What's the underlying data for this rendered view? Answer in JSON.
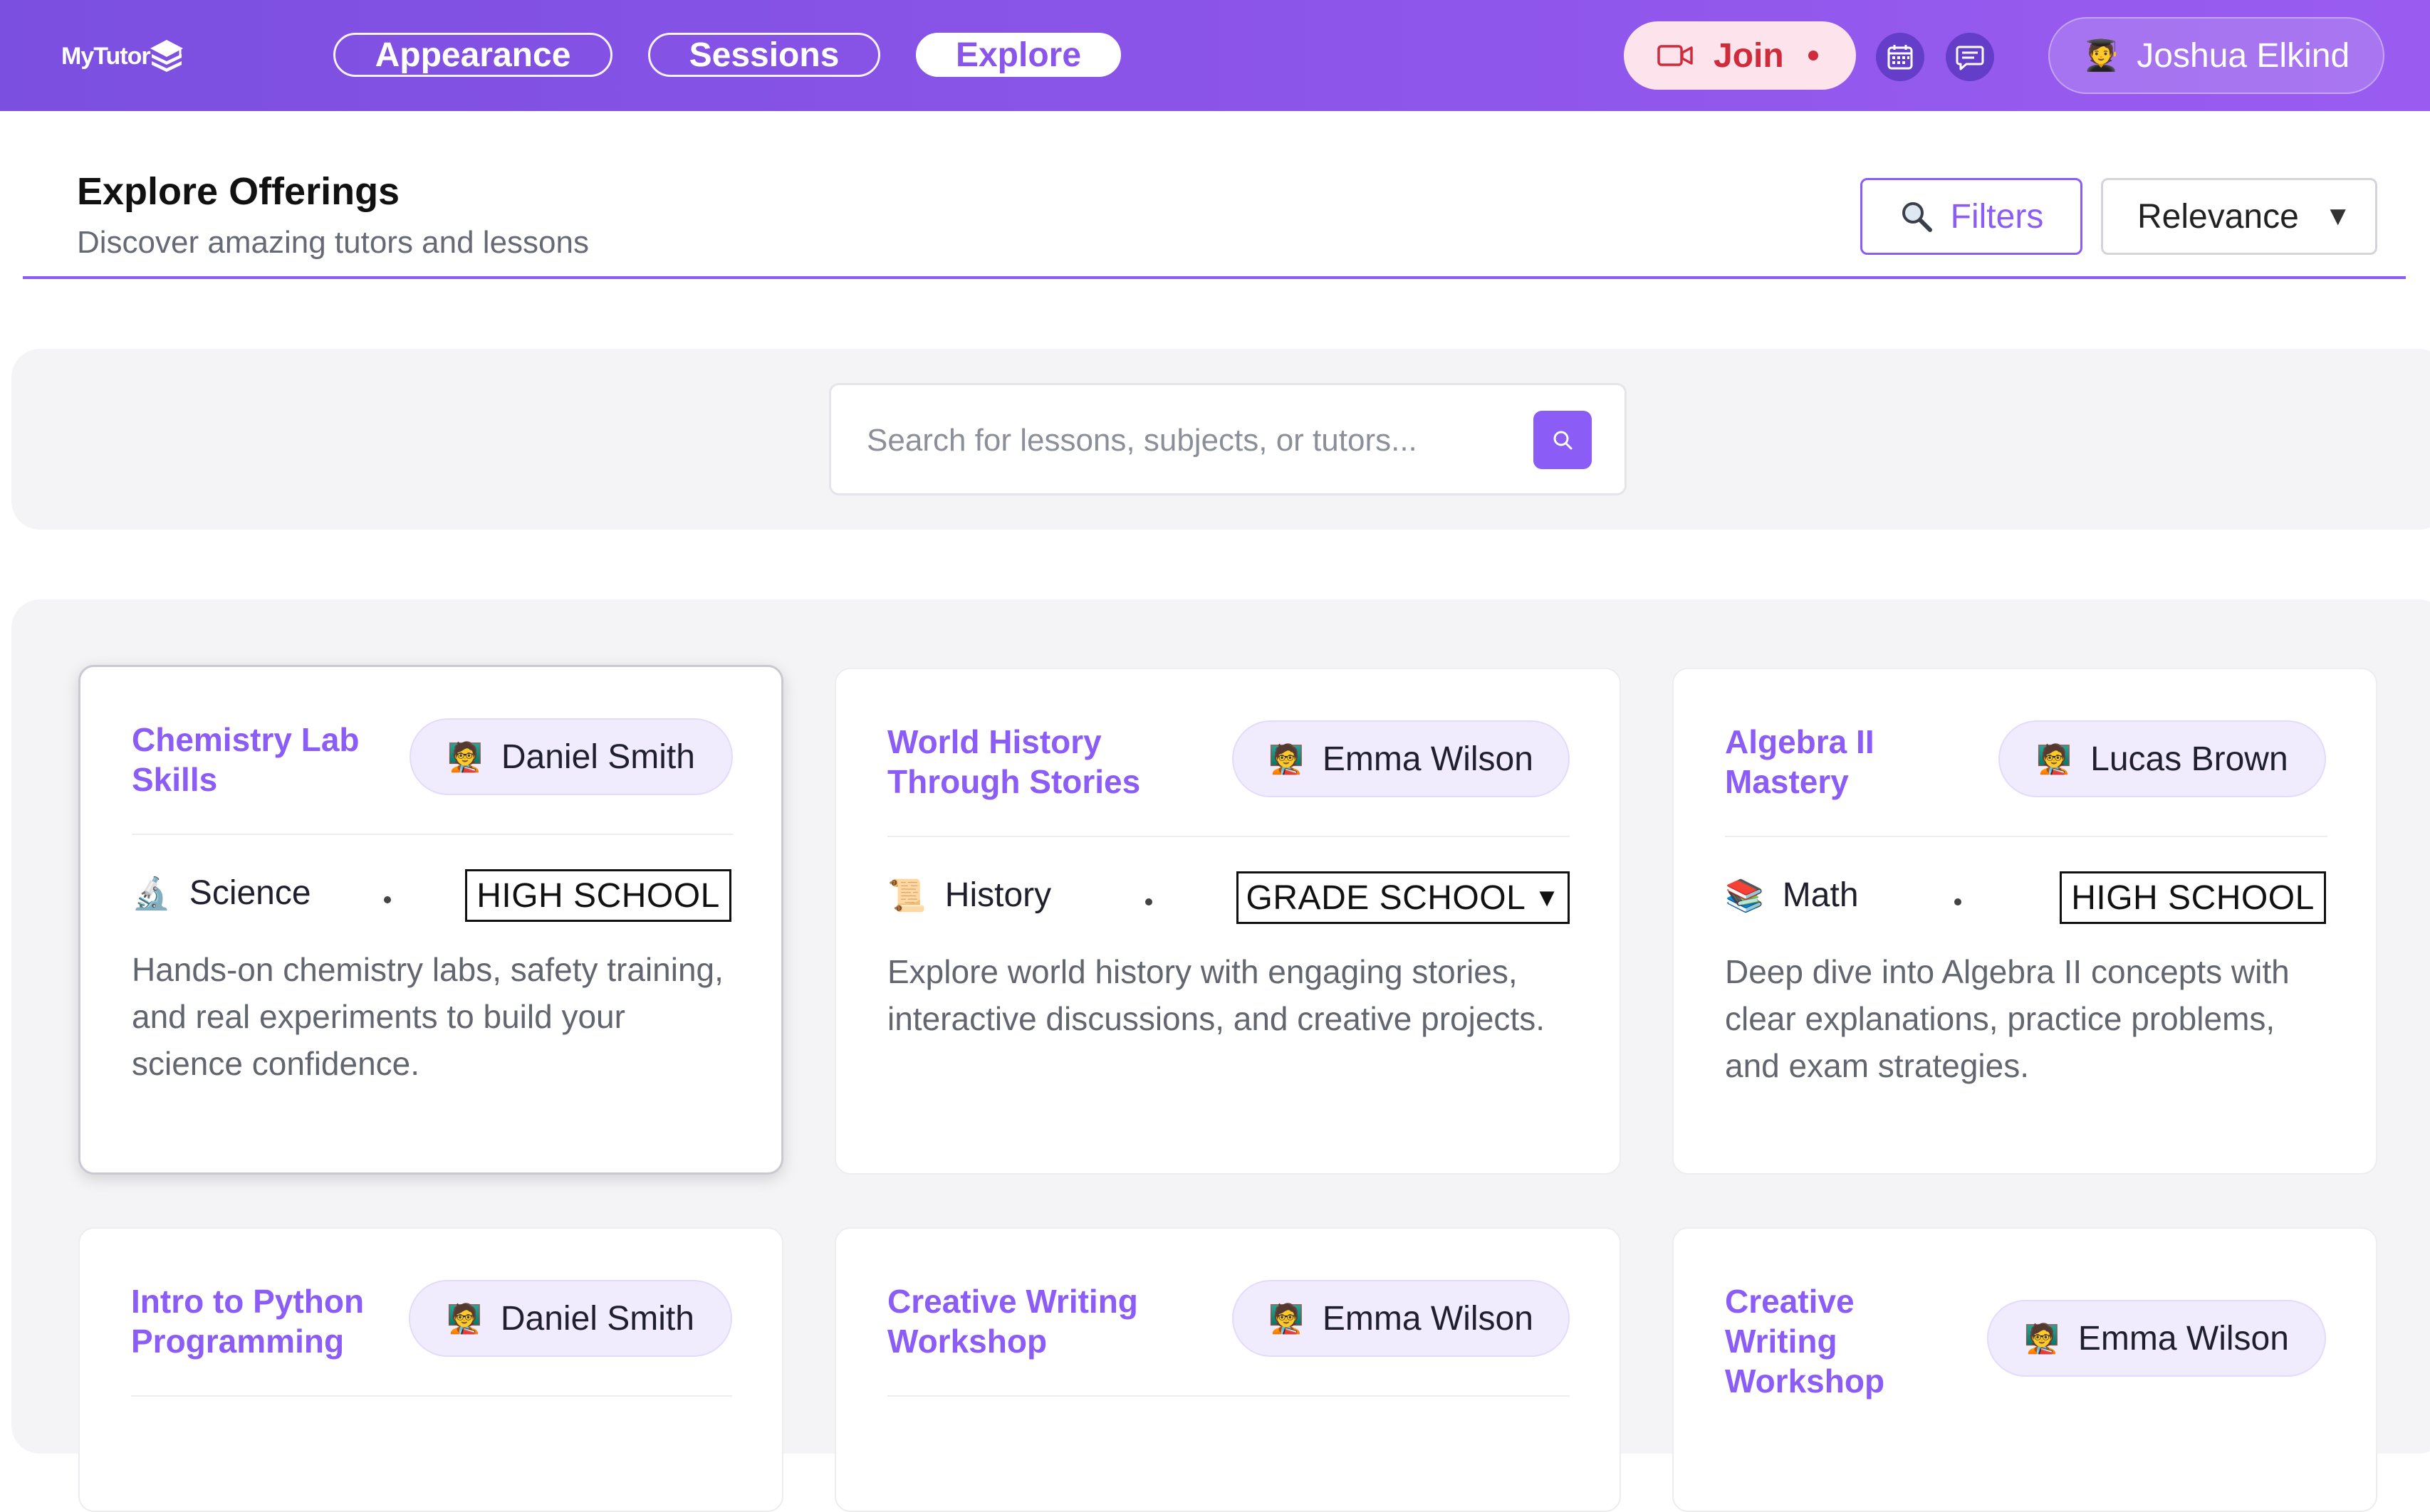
{
  "app": {
    "logo_text": "MyTutor",
    "logo_icon": "book-stack-icon"
  },
  "nav": {
    "tabs": [
      {
        "label": "Appearance",
        "active": false
      },
      {
        "label": "Sessions",
        "active": false
      },
      {
        "label": "Explore",
        "active": true
      }
    ],
    "join_label": "Join",
    "join_icon": "video-camera-icon",
    "calendar_icon": "calendar-icon",
    "messages_icon": "chat-icon",
    "user": {
      "name": "Joshua Elkind",
      "avatar": "🧑‍🎓"
    }
  },
  "header": {
    "title": "Explore Offerings",
    "subtitle": "Discover amazing tutors and lessons",
    "filters_label": "Filters",
    "sort_label": "Relevance",
    "sort_caret": "▼"
  },
  "search": {
    "placeholder": "Search for lessons, subjects, or tutors...",
    "value": ""
  },
  "cards": [
    {
      "title": "Chemistry Lab Skills",
      "tutor": "Daniel Smith",
      "tutor_avatar": "🧑‍🏫",
      "subject_icon": "🔬",
      "subject": "Science",
      "level": "HIGH SCHOOL",
      "level_caret": "",
      "description": "Hands-on chemistry labs, safety training, and real experiments to build your science confidence."
    },
    {
      "title": "World History Through Stories",
      "tutor": "Emma Wilson",
      "tutor_avatar": "🧑‍🏫",
      "subject_icon": "📜",
      "subject": "History",
      "level": "GRADE SCHOOL",
      "level_caret": "▼",
      "description": "Explore world history with engaging stories, interactive discussions, and creative projects."
    },
    {
      "title": "Algebra II Mastery",
      "tutor": "Lucas Brown",
      "tutor_avatar": "🧑‍🏫",
      "subject_icon": "📚",
      "subject": "Math",
      "level": "HIGH SCHOOL",
      "level_caret": "",
      "description": "Deep dive into Algebra II concepts with clear explanations, practice problems, and exam strategies."
    },
    {
      "title": "Intro to Python Programming",
      "tutor": "Daniel Smith",
      "tutor_avatar": "🧑‍🏫"
    },
    {
      "title": "Creative Writing Workshop",
      "tutor": "Emma Wilson",
      "tutor_avatar": "🧑‍🏫"
    },
    {
      "title": "Creative Writing Workshop",
      "tutor": "Emma Wilson",
      "tutor_avatar": "🧑‍🏫"
    }
  ],
  "colors": {
    "accent": "#8b5cf6",
    "header_gradient_start": "#7b4fe0",
    "header_gradient_end": "#9a5cf0",
    "join_background": "#fde4ec",
    "join_text": "#d02b3b",
    "panel_background": "#f4f4f7"
  }
}
